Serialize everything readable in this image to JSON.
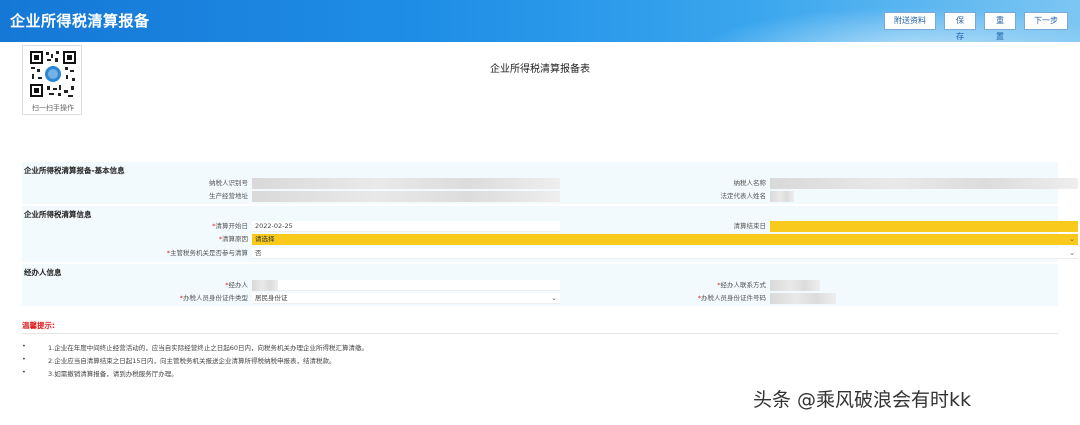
{
  "header": {
    "title": "企业所得税清算报备",
    "buttons": [
      "附送资料",
      "保存",
      "重置",
      "下一步"
    ]
  },
  "qr": {
    "caption": "扫一扫手操作"
  },
  "form_title": "企业所得税清算报备表",
  "basic": {
    "heading": "企业所得税清算报备-基本信息",
    "taxpayer_id_label": "纳税人识别号",
    "taxpayer_name_label": "纳税人名称",
    "address_label": "生产经营地址",
    "legal_rep_label": "法定代表人姓名"
  },
  "liquidation": {
    "heading": "企业所得税清算信息",
    "start_label": "清算开始日",
    "start_value": "2022-02-25",
    "end_label": "清算结束日",
    "reason_label": "清算原因",
    "reason_value": "请选择",
    "participate_label": "主管税务机关是否参与清算",
    "participate_value": "否"
  },
  "agent": {
    "heading": "经办人信息",
    "name_label": "经办人",
    "contact_label": "经办人联系方式",
    "id_type_label": "办税人员身份证件类型",
    "id_type_value": "居民身份证",
    "id_no_label": "办税人员身份证件号码"
  },
  "tips": {
    "title": "温馨提示:",
    "items": [
      "1.企业在年度中间终止经营活动的，应当自实际经营终止之日起60日内，向税务机关办理企业所得税汇算清缴。",
      "2.企业应当自清算结束之日起15日内，向主管税务机关报送企业清算所得税纳税申报表，结清税款。",
      "3.如需撤销清算报备，请到办税服务厅办理。"
    ]
  },
  "watermark": "头条 @乘风破浪会有时kk",
  "colors": {
    "header": "#1f8ee6",
    "highlight": "#f9c91c",
    "warning": "#e02020"
  }
}
